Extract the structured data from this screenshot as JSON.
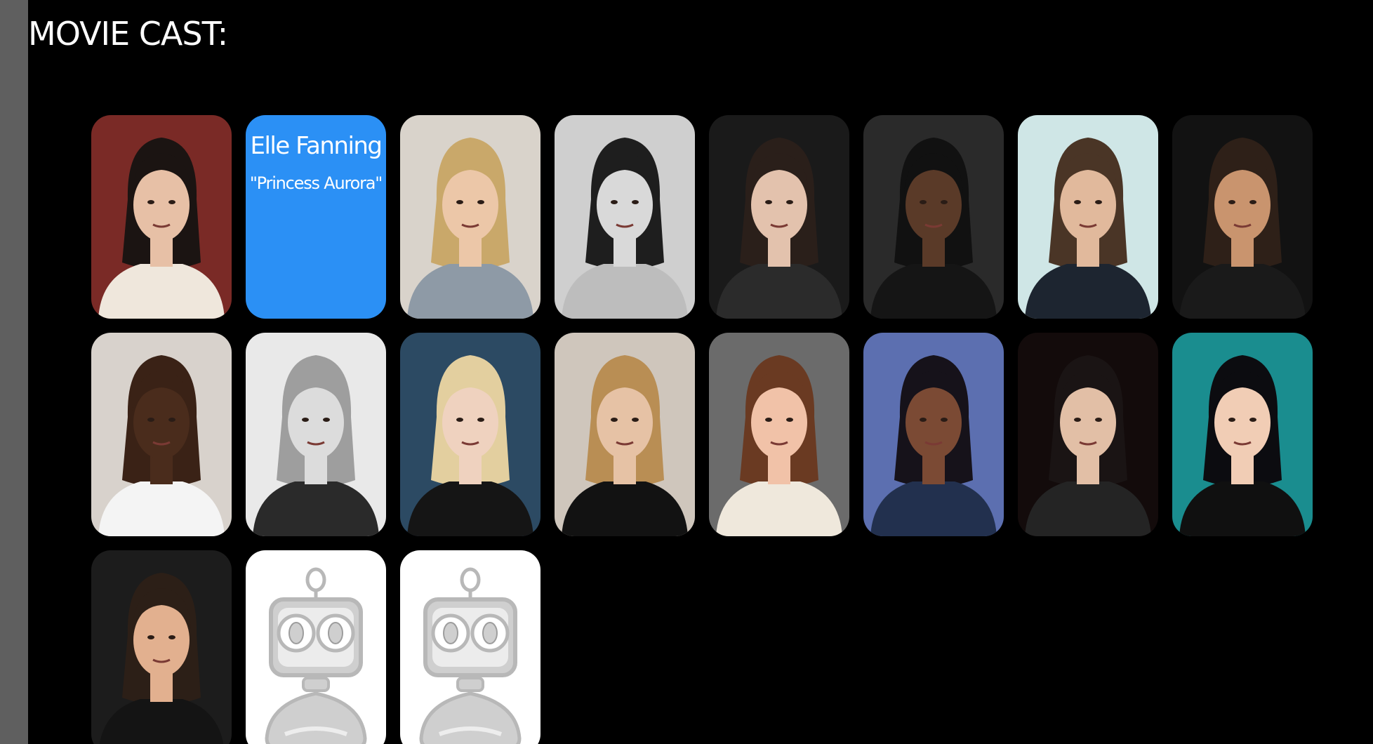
{
  "section": {
    "title": "MOVIE CAST:"
  },
  "cast": [
    {
      "photo": "portrait-dark-hair-woman",
      "bg": "#7a2a26",
      "skin": "#e7c0a6",
      "hair": "#1b1412",
      "top": "#efe7dc",
      "actor": "",
      "character": ""
    },
    {
      "photo": "portrait-highlighted",
      "bg": "#2b90f5",
      "skin": "#f0cfb5",
      "hair": "#d9c08a",
      "top": "#ffffff",
      "actor": "Elle Fanning",
      "character": "\"Princess Aurora\""
    },
    {
      "photo": "portrait-blonde-woman",
      "bg": "#d9d3cb",
      "skin": "#ecc7a8",
      "hair": "#c9a86a",
      "top": "#8e9aa6",
      "actor": "",
      "character": ""
    },
    {
      "photo": "portrait-bw-young-man",
      "bg": "#cfcfcf",
      "skin": "#d9d9d9",
      "hair": "#1e1e1e",
      "top": "#bdbdbd",
      "actor": "",
      "character": ""
    },
    {
      "photo": "portrait-man-scarf",
      "bg": "#1a1a1a",
      "skin": "#e3c2ad",
      "hair": "#2a1f1a",
      "top": "#2b2b2b",
      "actor": "",
      "character": ""
    },
    {
      "photo": "portrait-man-dark",
      "bg": "#2a2a2a",
      "skin": "#5a3a28",
      "hair": "#111111",
      "top": "#151515",
      "actor": "",
      "character": ""
    },
    {
      "photo": "portrait-man-leather-jacket",
      "bg": "#cfe6e6",
      "skin": "#e1b99c",
      "hair": "#4a3526",
      "top": "#1d2530",
      "actor": "",
      "character": ""
    },
    {
      "photo": "portrait-man-whiskey",
      "bg": "#121212",
      "skin": "#c9946e",
      "hair": "#2e2018",
      "top": "#1a1a1a",
      "actor": "",
      "character": ""
    },
    {
      "photo": "portrait-bald-man",
      "bg": "#d8d2cc",
      "skin": "#4a2c1c",
      "hair": "#3a2216",
      "top": "#f4f4f4",
      "actor": "",
      "character": ""
    },
    {
      "photo": "portrait-bw-blonde-woman",
      "bg": "#e9e9e9",
      "skin": "#dcdcdc",
      "hair": "#9e9e9e",
      "top": "#2a2a2a",
      "actor": "",
      "character": ""
    },
    {
      "photo": "portrait-platinum-woman",
      "bg": "#2c4a63",
      "skin": "#efd2bf",
      "hair": "#e3cf9f",
      "top": "#151515",
      "actor": "",
      "character": ""
    },
    {
      "photo": "portrait-woman-necklace",
      "bg": "#cfc6bc",
      "skin": "#e6c2a5",
      "hair": "#b98e54",
      "top": "#121212",
      "actor": "",
      "character": ""
    },
    {
      "photo": "portrait-woman-scarf",
      "bg": "#6b6b6b",
      "skin": "#f1c2a8",
      "hair": "#6a3a22",
      "top": "#efe8dc",
      "actor": "",
      "character": ""
    },
    {
      "photo": "portrait-woman-afro",
      "bg": "#5c6fb0",
      "skin": "#7b4a34",
      "hair": "#16121a",
      "top": "#22304e",
      "actor": "",
      "character": ""
    },
    {
      "photo": "portrait-man-slicked-hair",
      "bg": "#130b0b",
      "skin": "#e2bfa6",
      "hair": "#1a1414",
      "top": "#242424",
      "actor": "",
      "character": ""
    },
    {
      "photo": "portrait-woman-teal",
      "bg": "#1a8d8f",
      "skin": "#f1cdb5",
      "hair": "#0c0c10",
      "top": "#101010",
      "actor": "",
      "character": ""
    },
    {
      "photo": "portrait-smiling-man",
      "bg": "#1c1c1c",
      "skin": "#e2b08f",
      "hair": "#2c1f17",
      "top": "#141414",
      "actor": "",
      "character": ""
    },
    {
      "photo": "robot-placeholder-icon",
      "actor": "",
      "character": ""
    },
    {
      "photo": "robot-placeholder-icon",
      "actor": "",
      "character": ""
    }
  ]
}
